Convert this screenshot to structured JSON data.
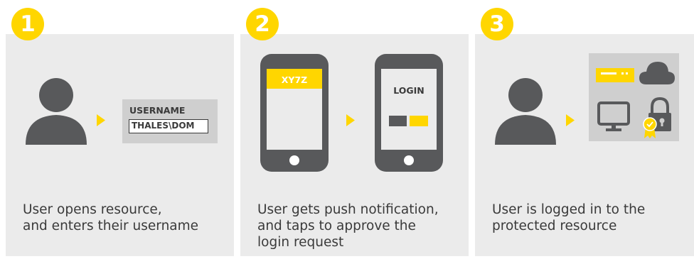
{
  "steps": [
    {
      "number": "1",
      "username_label": "USERNAME",
      "username_value": "THALES\\DOM",
      "caption": [
        "User opens resource,",
        "and enters their username"
      ]
    },
    {
      "number": "2",
      "phone1_code": "XY7Z",
      "phone2_label": "LOGIN",
      "caption": [
        "User gets push notification,",
        "and taps to approve the",
        "login request"
      ]
    },
    {
      "number": "3",
      "caption": [
        "User is logged in to the",
        "protected resource"
      ]
    }
  ],
  "colors": {
    "accent": "#ffd600",
    "dark": "#58595b",
    "panel": "#ebebeb",
    "box": "#cfcfcf"
  },
  "icons": [
    "user-icon",
    "arrow-right-icon",
    "phone-icon",
    "server-icon",
    "cloud-icon",
    "monitor-icon",
    "padlock-icon",
    "certificate-badge-icon"
  ]
}
